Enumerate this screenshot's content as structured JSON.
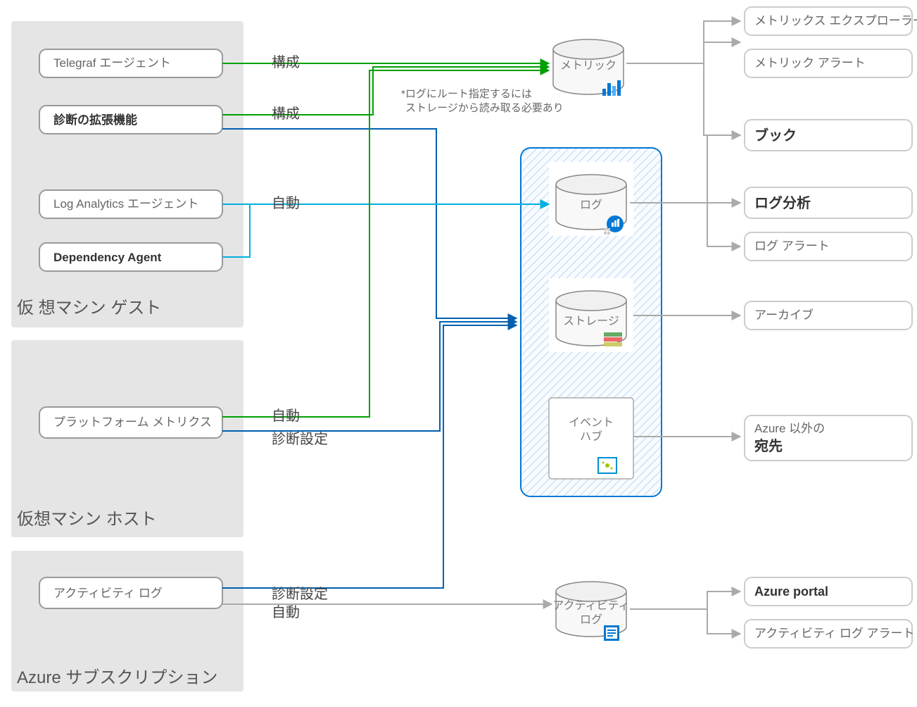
{
  "sources": {
    "guest": {
      "title": "仮 想マシン ゲスト",
      "boxes": {
        "telegraf": "Telegraf エージェント",
        "diag_ext": "診断の拡張機能",
        "log_analytics": "Log Analytics エージェント",
        "dependency": "Dependency Agent"
      }
    },
    "host": {
      "title": "仮想マシン ホスト",
      "boxes": {
        "platform": "プラットフォーム メトリクス"
      }
    },
    "subscription": {
      "title": "Azure サブスクリプション",
      "boxes": {
        "activity": "アクティビティ ログ"
      }
    }
  },
  "edge_labels": {
    "config1": "構成",
    "config2": "構成",
    "auto1": "自動",
    "auto2": "自動",
    "diag1": "診断設定",
    "diag2": "診断設定",
    "auto3": "自動"
  },
  "note": {
    "line1": "*ログにルート指定するには",
    "line2": "ストレージから読み取る必要あり"
  },
  "stores": {
    "metrics": "メトリック",
    "logs": "ログ",
    "storage": "ストレージ",
    "eventhub_l1": "イベント",
    "eventhub_l2": "ハブ",
    "activity_l1": "アクティビティ",
    "activity_l2": "ログ"
  },
  "destinations": {
    "metrics_explorer": "メトリックス エクスプローラー",
    "metric_alert": "メトリック アラート",
    "workbook": "ブック",
    "log_analytics": "ログ分析",
    "log_alert": "ログ アラート",
    "archive": "アーカイブ",
    "external_l1": "Azure 以外の",
    "external_l2": "宛先",
    "portal": "Azure portal",
    "activity_alert": "アクティビティ ログ アラート"
  }
}
